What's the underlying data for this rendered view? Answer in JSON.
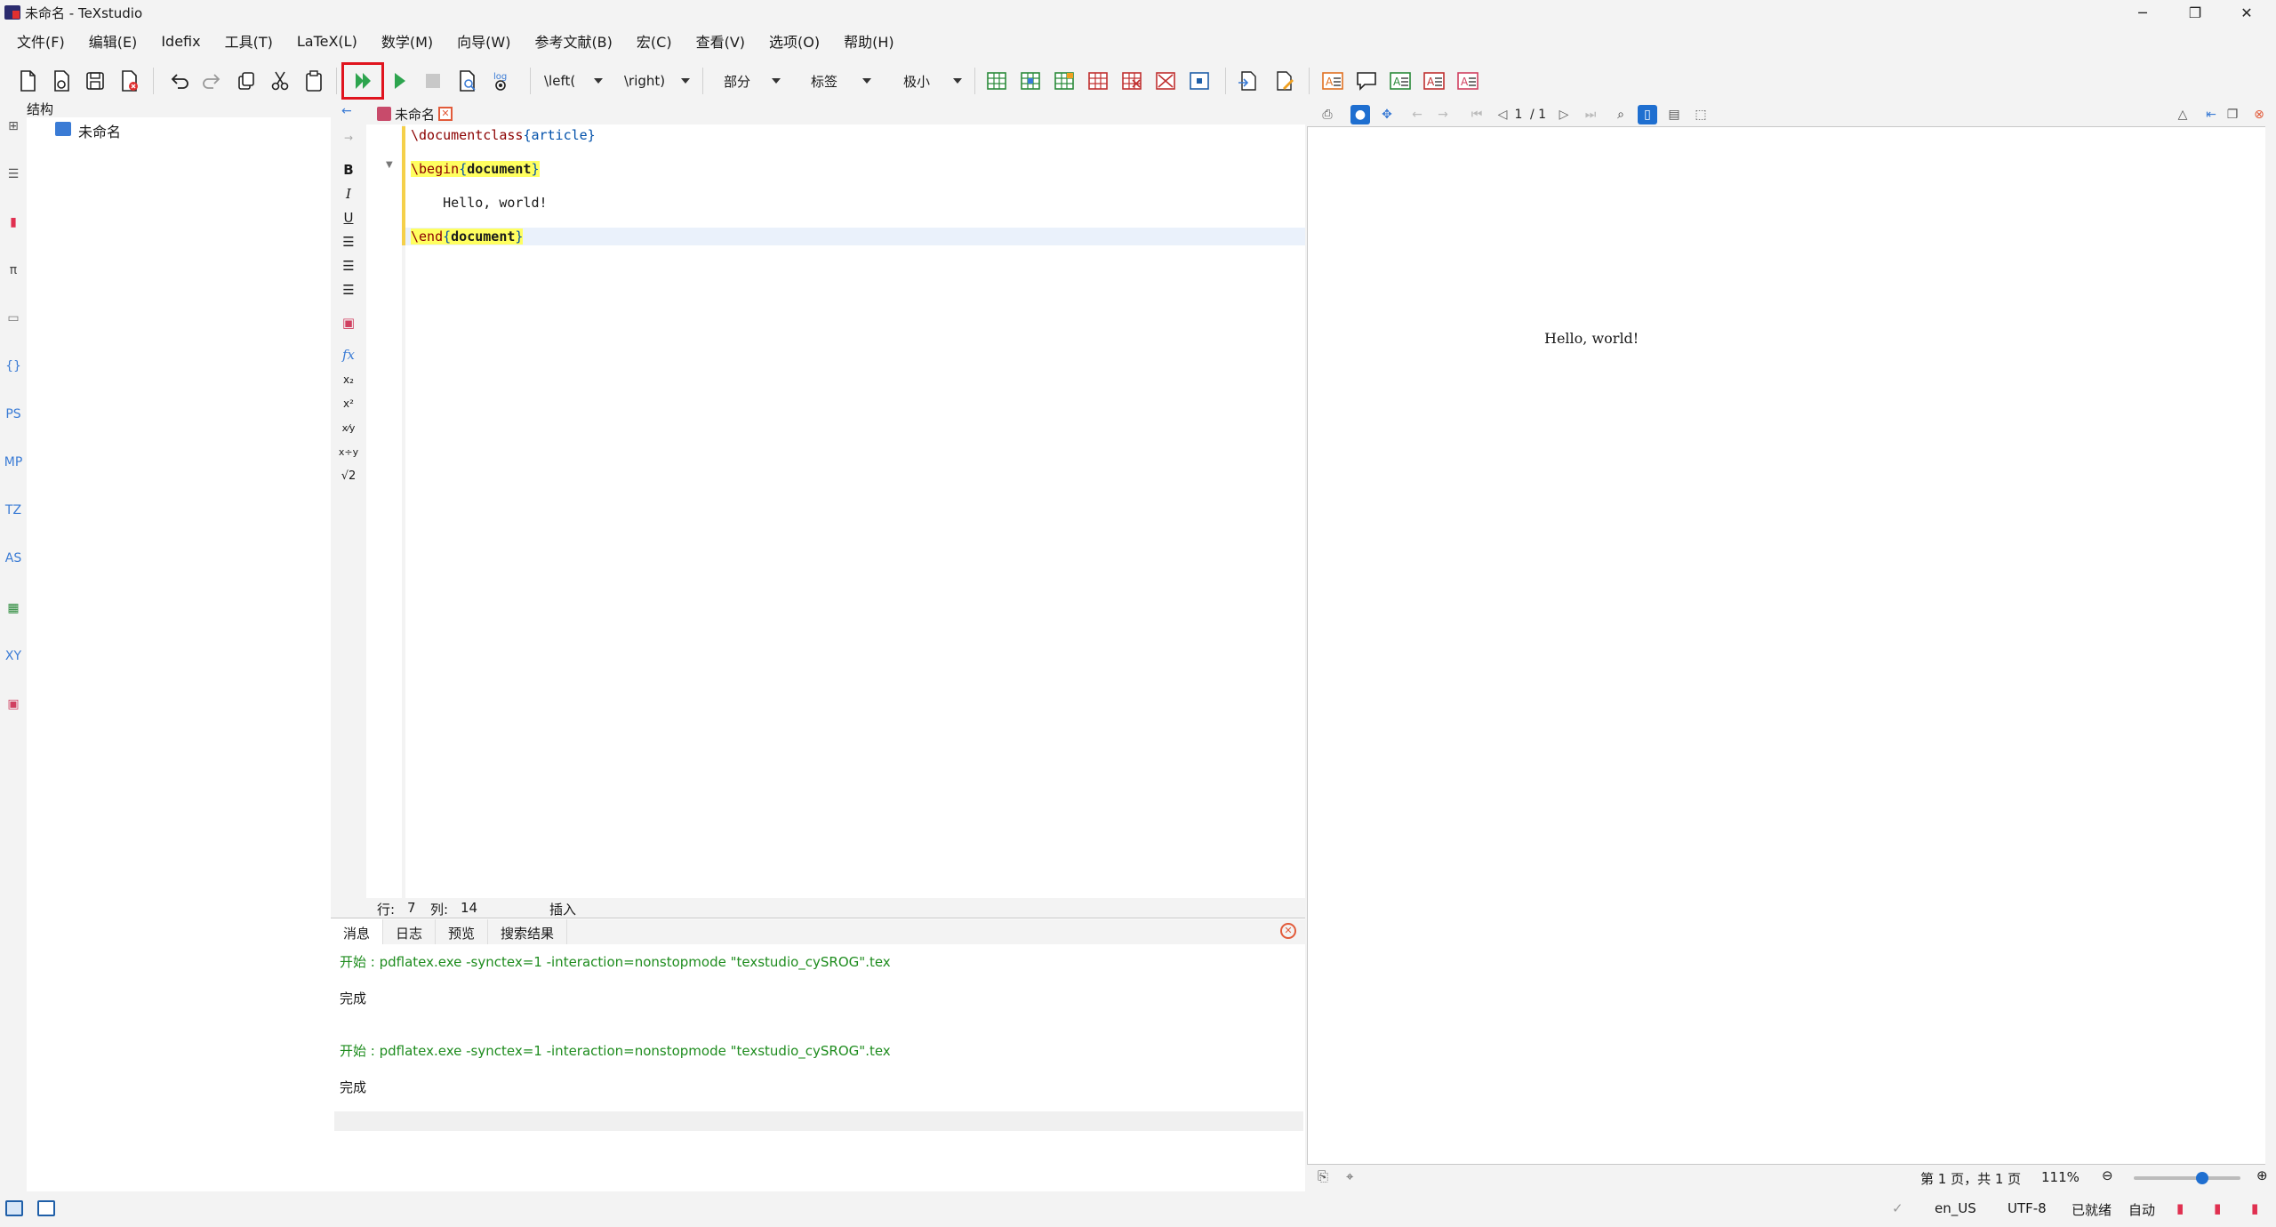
{
  "window": {
    "title": "未命名 - TeXstudio",
    "minimize": "─",
    "maximize": "❐",
    "close": "✕"
  },
  "menu": [
    "文件(F)",
    "编辑(E)",
    "Idefix",
    "工具(T)",
    "LaTeX(L)",
    "数学(M)",
    "向导(W)",
    "参考文献(B)",
    "宏(C)",
    "查看(V)",
    "选项(O)",
    "帮助(H)"
  ],
  "toolbar": {
    "combos": {
      "left": "\\left(",
      "right": "\\right)",
      "section": "部分",
      "label": "标签",
      "size": "极小"
    },
    "colors": {
      "compile_highlight": "#e0141e",
      "green": "#2da44e"
    }
  },
  "sidebar": {
    "items": [
      "structure-icon",
      "toc-icon",
      "bookmark-icon",
      "pi",
      "folder-icon",
      "braces",
      "PS",
      "MP",
      "TZ",
      "AS",
      "table-icon",
      "XY",
      "image-icon"
    ],
    "pi": "π",
    "braces": "{}",
    "ps": "PS",
    "mp": "MP",
    "tz": "TZ",
    "as": "AS",
    "xy": "XY"
  },
  "structure": {
    "title": "结构",
    "root": "未命名"
  },
  "editor": {
    "tab": "未命名",
    "lines": {
      "l1_cmd": "\\documentclass",
      "l1_arg": "{article}",
      "l2_cmd": "\\begin",
      "l2_open": "{",
      "l2_arg": "document",
      "l2_close": "}",
      "l3": "    Hello, world!",
      "l4_cmd": "\\end",
      "l4_open": "{",
      "l4_arg": "document",
      "l4_close": "}"
    },
    "format_tools": {
      "bold": "B",
      "italic": "I",
      "underline": "U",
      "fx": "fx",
      "sub": "x₂",
      "sup": "x²",
      "sqrt": "√2"
    },
    "status": {
      "row_label": "行:",
      "row": "7",
      "col_label": "列:",
      "col": "14",
      "mode": "插入"
    }
  },
  "messages": {
    "tabs": [
      "消息",
      "日志",
      "预览",
      "搜索结果"
    ],
    "lines": [
      {
        "text": "开始 : pdflatex.exe -synctex=1 -interaction=nonstopmode \"texstudio_cySROG\".tex"
      },
      {
        "text": "完成"
      },
      {
        "text": "开始 : pdflatex.exe -synctex=1 -interaction=nonstopmode \"texstudio_cySROG\".tex"
      },
      {
        "text": "完成"
      }
    ]
  },
  "pdf": {
    "page": "1",
    "of": "/ 1",
    "content": "Hello, world!",
    "page_info": "第 1 页，共 1 页",
    "zoom": "111%"
  },
  "statusbar": {
    "lang": "en_US",
    "encoding": "UTF-8",
    "ready": "已就绪",
    "auto": "自动"
  }
}
